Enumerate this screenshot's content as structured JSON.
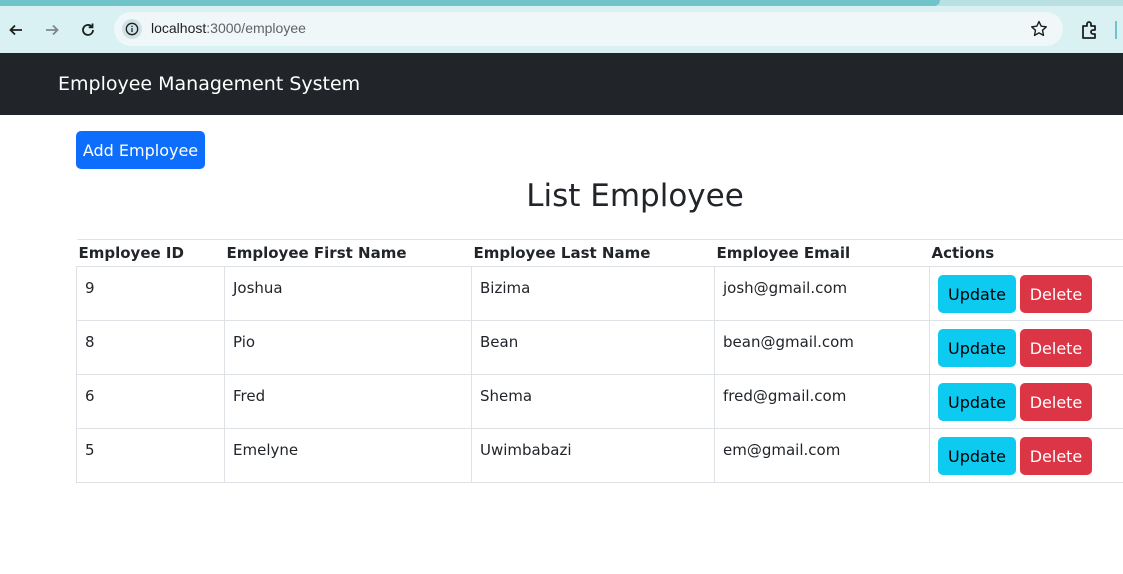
{
  "browser": {
    "url_host": "localhost",
    "url_path": ":3000/employee"
  },
  "navbar": {
    "brand": "Employee Management System"
  },
  "main": {
    "add_button": "Add Employee",
    "title": "List Employee",
    "columns": [
      "Employee ID",
      "Employee First Name",
      "Employee Last Name",
      "Employee Email",
      "Actions"
    ],
    "rows": [
      {
        "id": "9",
        "first": "Joshua",
        "last": "Bizima",
        "email": "josh@gmail.com"
      },
      {
        "id": "8",
        "first": "Pio",
        "last": "Bean",
        "email": "bean@gmail.com"
      },
      {
        "id": "6",
        "first": "Fred",
        "last": "Shema",
        "email": "fred@gmail.com"
      },
      {
        "id": "5",
        "first": "Emelyne",
        "last": "Uwimbabazi",
        "email": "em@gmail.com"
      }
    ],
    "update_label": "Update",
    "delete_label": "Delete"
  },
  "colors": {
    "navbar_bg": "#212529",
    "primary": "#0d6efd",
    "info": "#0dcaf0",
    "danger": "#dc3545"
  },
  "icons": [
    "back-icon",
    "forward-icon",
    "reload-icon",
    "site-info-icon",
    "bookmark-star-icon",
    "extensions-icon"
  ]
}
